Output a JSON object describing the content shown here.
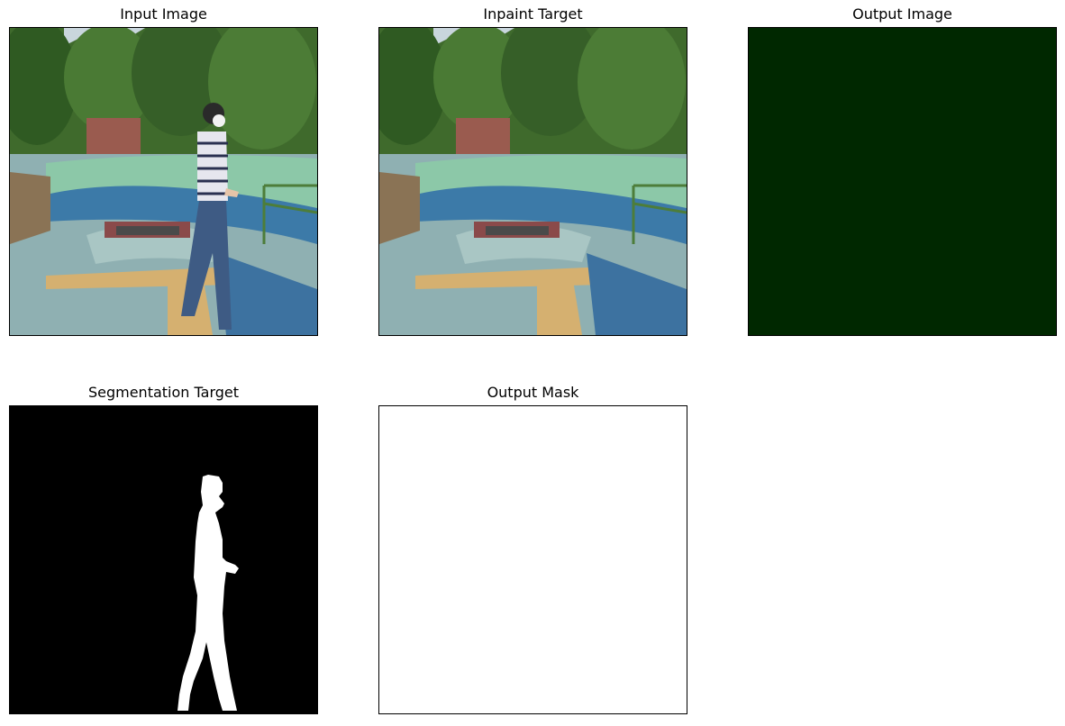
{
  "figure": {
    "panels": [
      {
        "id": "input",
        "title": "Input Image",
        "content": "park scene with walking person"
      },
      {
        "id": "inpaint",
        "title": "Inpaint Target",
        "content": "park scene without person"
      },
      {
        "id": "output",
        "title": "Output Image",
        "fill_color": "#002800"
      },
      {
        "id": "segmentation",
        "title": "Segmentation Target",
        "background_color": "#000000",
        "mask_color": "#ffffff"
      },
      {
        "id": "mask",
        "title": "Output Mask",
        "fill_color": "#ffffff"
      }
    ]
  }
}
